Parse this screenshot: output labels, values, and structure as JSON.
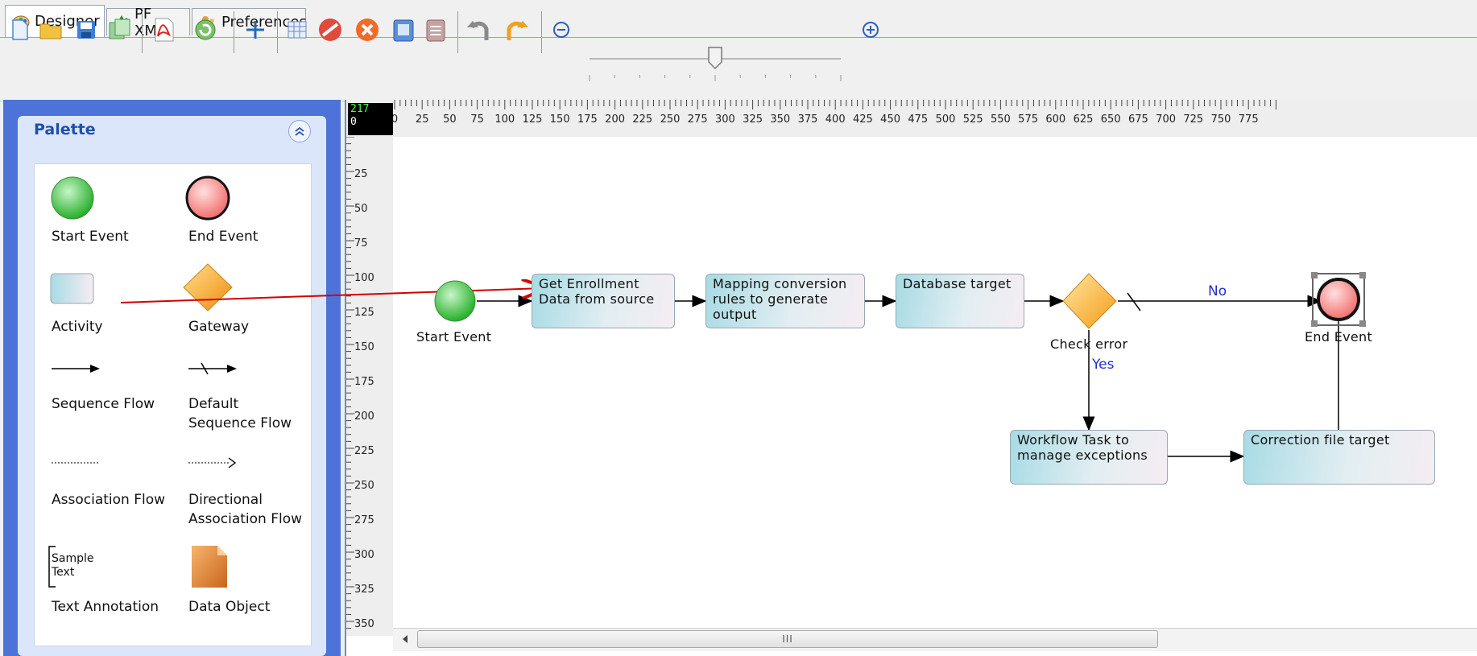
{
  "tabs": [
    {
      "label": "Designer",
      "icon": "palette-icon",
      "active": true
    },
    {
      "label": "PF XML",
      "icon": "xml-icon",
      "active": false
    },
    {
      "label": "Preferences",
      "icon": "preferences-icon",
      "active": false
    }
  ],
  "toolbar": {
    "icons": [
      "new-file-icon",
      "open-folder-icon",
      "save-icon",
      "save-all-icon",
      "pdf-export-icon",
      "refresh-icon",
      "add-icon",
      "grid-icon",
      "stop-icon",
      "delete-icon",
      "copy-icon",
      "paste-icon",
      "undo-icon",
      "redo-icon",
      "zoom-out-icon",
      "zoom-in-icon"
    ],
    "zoom_level": 0.5
  },
  "palette": {
    "title": "Palette",
    "items": [
      {
        "label": "Start Event",
        "icon": "start-event-icon"
      },
      {
        "label": "End Event",
        "icon": "end-event-icon"
      },
      {
        "label": "Activity",
        "icon": "activity-icon"
      },
      {
        "label": "Gateway",
        "icon": "gateway-icon"
      },
      {
        "label": "Sequence Flow",
        "icon": "sequence-flow-icon"
      },
      {
        "label": "Default\nSequence Flow",
        "icon": "default-sequence-flow-icon"
      },
      {
        "label": "Association Flow",
        "icon": "association-flow-icon"
      },
      {
        "label": "Directional\nAssociation Flow",
        "icon": "directional-association-flow-icon"
      },
      {
        "label": "Text Annotation",
        "icon": "text-annotation-icon",
        "sample": "Sample\nText"
      },
      {
        "label": "Data Object",
        "icon": "data-object-icon"
      }
    ]
  },
  "canvas": {
    "coords": {
      "x": "217",
      "y": "0"
    },
    "ruler_x": [
      "0",
      "25",
      "50",
      "75",
      "100",
      "125",
      "150",
      "175",
      "200",
      "225",
      "250",
      "275",
      "300",
      "325",
      "350",
      "375",
      "400",
      "425",
      "450",
      "475",
      "500",
      "525",
      "550",
      "575",
      "600",
      "625",
      "650",
      "675",
      "700",
      "725",
      "750",
      "775"
    ],
    "ruler_y": [
      "25",
      "50",
      "75",
      "100",
      "125",
      "150",
      "175",
      "200",
      "225",
      "250",
      "275",
      "300",
      "325",
      "350"
    ],
    "nodes": {
      "start": "Start Event",
      "get_enrollment": "Get Enrollment\nData from source",
      "mapping": "Mapping conversion\nrules to generate\noutput",
      "database": "Database target",
      "gateway": "Check error",
      "end": "End Event",
      "workflow": "Workflow Task to\nmanage exceptions",
      "correction": "Correction file target"
    },
    "flow_labels": {
      "no": "No",
      "yes": "Yes"
    },
    "scrollbar_grip": "III"
  }
}
